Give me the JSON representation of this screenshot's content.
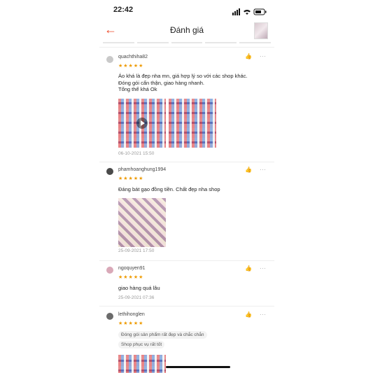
{
  "status": {
    "time": "22:42"
  },
  "header": {
    "title": "Đánh giá"
  },
  "reviews": [
    {
      "username": "quachthiha82",
      "stars": "★★★★★",
      "text_lines": [
        "Áo khá là đẹp nha mn, giá hợp lý so với các shop khác.",
        "Đóng gói cẩn thận, giao hàng nhanh.",
        "Tổng thể khá Ok"
      ],
      "date": "06-10-2021 15:50"
    },
    {
      "username": "phamhoanghung1994",
      "stars": "★★★★★",
      "text_lines": [
        "Đáng bát gạo đồng tiền. Chất đẹp nha shop"
      ],
      "date": "25-09-2021 17:50"
    },
    {
      "username": "ngoquyen91",
      "stars": "★★★★★",
      "text_lines": [
        "giao hàng quá lâu"
      ],
      "date": "25-09-2021 07:36"
    },
    {
      "username": "lethihonglen",
      "stars": "★★★★★",
      "tags": [
        "Đóng gói sản phẩm rất đẹp và chắc chắn",
        "Shop phục vụ rất tốt"
      ]
    }
  ],
  "icons": {
    "like": "thumbs-up-icon",
    "more": "more-dots-icon",
    "back": "back-arrow-icon"
  },
  "colors": {
    "accent": "#ee4d2d",
    "star": "#ee9a00"
  }
}
